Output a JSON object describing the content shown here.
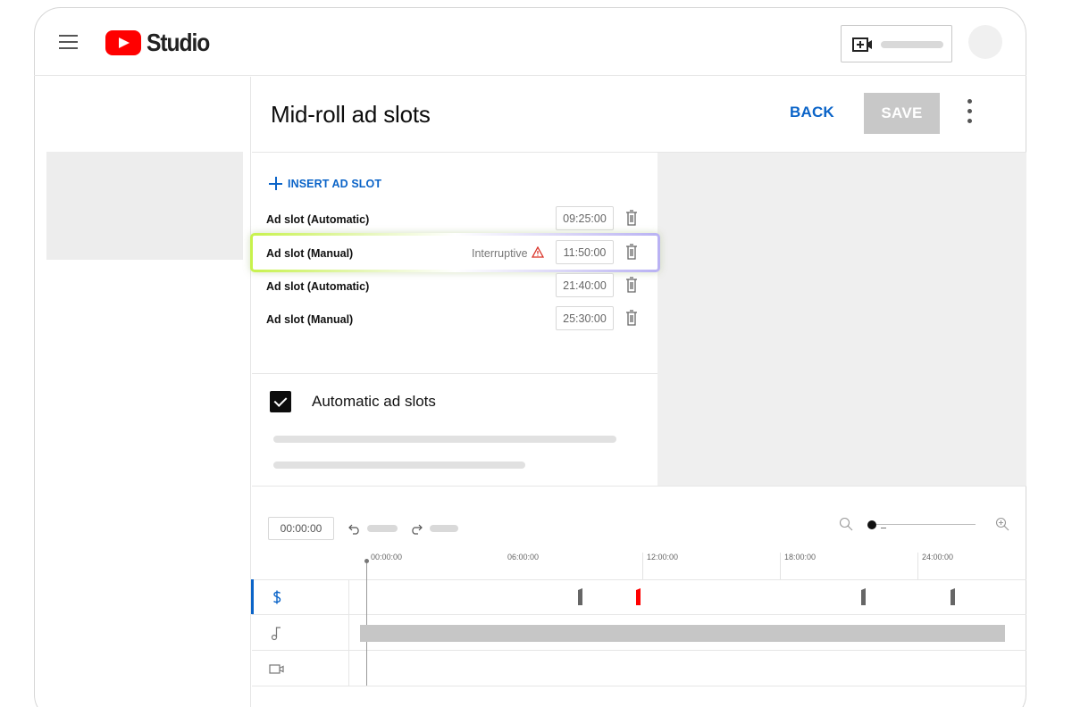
{
  "app": {
    "title": "Studio"
  },
  "header": {
    "page_title": "Mid-roll ad slots",
    "back_label": "BACK",
    "save_label": "SAVE"
  },
  "ad_slots": {
    "insert_label": "INSERT AD SLOT",
    "items": [
      {
        "label": "Ad slot (Automatic)",
        "time": "09:25:00"
      },
      {
        "label": "Ad slot (Manual)",
        "time": "11:50:00",
        "warning": "Interruptive"
      },
      {
        "label": "Ad slot (Automatic)",
        "time": "21:40:00"
      },
      {
        "label": "Ad slot (Manual)",
        "time": "25:30:00"
      }
    ]
  },
  "automatic": {
    "label": "Automatic ad slots",
    "checked": true
  },
  "timeline": {
    "current_time": "00:00:00",
    "ruler": [
      "00:00:00",
      "06:00:00",
      "12:00:00",
      "18:00:00",
      "24:00:00"
    ]
  },
  "colors": {
    "accent": "#0b64c8",
    "brand": "#ff0000",
    "warning": "#d93025",
    "marker_manual_warning": "#ff0000",
    "marker_default": "#666666"
  },
  "icons": {
    "menu": "hamburger-menu-icon",
    "create": "video-add-icon",
    "more": "more-vertical-icon",
    "delete": "trash-icon",
    "warning": "warning-triangle-icon",
    "undo": "undo-icon",
    "redo": "redo-icon",
    "zoom_out": "zoom-out-icon",
    "zoom_in": "zoom-in-icon",
    "ads_track": "dollar-icon",
    "audio_track": "music-note-icon",
    "video_track": "video-camera-icon"
  }
}
